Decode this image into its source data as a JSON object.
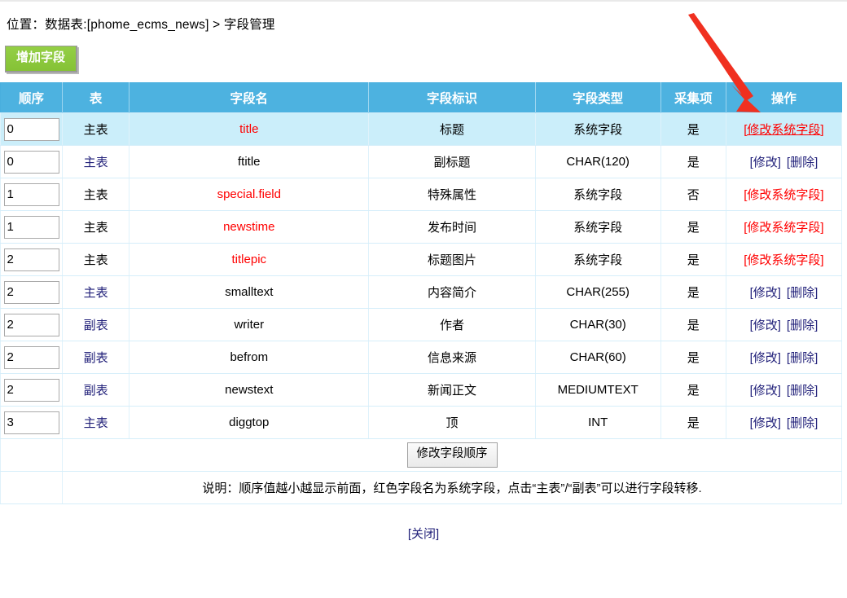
{
  "breadcrumb": {
    "text": "位置：数据表:[phome_ecms_news] > 字段管理"
  },
  "toolbar": {
    "add_field_label": "增加字段"
  },
  "table": {
    "headers": {
      "order": "顺序",
      "table": "表",
      "field_name": "字段名",
      "field_label": "字段标识",
      "field_type": "字段类型",
      "collect": "采集项",
      "operation": "操作"
    },
    "rows": [
      {
        "order": "0",
        "table": "主表",
        "table_is_link": false,
        "name": "title",
        "name_is_system": true,
        "label": "标题",
        "type": "系统字段",
        "collect": "是",
        "ops": [
          "[修改系统字段]"
        ],
        "ops_is_system": true,
        "highlighted": true,
        "op_active": true
      },
      {
        "order": "0",
        "table": "主表",
        "table_is_link": true,
        "name": "ftitle",
        "name_is_system": false,
        "label": "副标题",
        "type": "CHAR(120)",
        "collect": "是",
        "ops": [
          "[修改]",
          "[删除]"
        ],
        "ops_is_system": false,
        "highlighted": false,
        "op_active": false
      },
      {
        "order": "1",
        "table": "主表",
        "table_is_link": false,
        "name": "special.field",
        "name_is_system": true,
        "label": "特殊属性",
        "type": "系统字段",
        "collect": "否",
        "ops": [
          "[修改系统字段]"
        ],
        "ops_is_system": true,
        "highlighted": false,
        "op_active": false
      },
      {
        "order": "1",
        "table": "主表",
        "table_is_link": false,
        "name": "newstime",
        "name_is_system": true,
        "label": "发布时间",
        "type": "系统字段",
        "collect": "是",
        "ops": [
          "[修改系统字段]"
        ],
        "ops_is_system": true,
        "highlighted": false,
        "op_active": false
      },
      {
        "order": "2",
        "table": "主表",
        "table_is_link": false,
        "name": "titlepic",
        "name_is_system": true,
        "label": "标题图片",
        "type": "系统字段",
        "collect": "是",
        "ops": [
          "[修改系统字段]"
        ],
        "ops_is_system": true,
        "highlighted": false,
        "op_active": false
      },
      {
        "order": "2",
        "table": "主表",
        "table_is_link": true,
        "name": "smalltext",
        "name_is_system": false,
        "label": "内容简介",
        "type": "CHAR(255)",
        "collect": "是",
        "ops": [
          "[修改]",
          "[删除]"
        ],
        "ops_is_system": false,
        "highlighted": false,
        "op_active": false
      },
      {
        "order": "2",
        "table": "副表",
        "table_is_link": true,
        "name": "writer",
        "name_is_system": false,
        "label": "作者",
        "type": "CHAR(30)",
        "collect": "是",
        "ops": [
          "[修改]",
          "[删除]"
        ],
        "ops_is_system": false,
        "highlighted": false,
        "op_active": false
      },
      {
        "order": "2",
        "table": "副表",
        "table_is_link": true,
        "name": "befrom",
        "name_is_system": false,
        "label": "信息来源",
        "type": "CHAR(60)",
        "collect": "是",
        "ops": [
          "[修改]",
          "[删除]"
        ],
        "ops_is_system": false,
        "highlighted": false,
        "op_active": false
      },
      {
        "order": "2",
        "table": "副表",
        "table_is_link": true,
        "name": "newstext",
        "name_is_system": false,
        "label": "新闻正文",
        "type": "MEDIUMTEXT",
        "collect": "是",
        "ops": [
          "[修改]",
          "[删除]"
        ],
        "ops_is_system": false,
        "highlighted": false,
        "op_active": false
      },
      {
        "order": "3",
        "table": "主表",
        "table_is_link": true,
        "name": "diggtop",
        "name_is_system": false,
        "label": "顶",
        "type": "INT",
        "collect": "是",
        "ops": [
          "[修改]",
          "[删除]"
        ],
        "ops_is_system": false,
        "highlighted": false,
        "op_active": false
      }
    ],
    "footer": {
      "order_button_label": "修改字段顺序",
      "note": "说明：顺序值越小越显示前面，红色字段名为系统字段，点击“主表”/“副表”可以进行字段转移."
    }
  },
  "close": {
    "label": "[关闭]"
  },
  "annotation": {
    "arrow_color": "#F03020",
    "arrow_name": "red-pointer-arrow"
  },
  "colors": {
    "header_blue": "#4DB2E0",
    "row_highlight": "#CBEEFA",
    "system_red": "#FF0000",
    "link_blue": "#22217A",
    "add_button_green": "#8CC63F",
    "note_gray": "#8D8D8D"
  }
}
